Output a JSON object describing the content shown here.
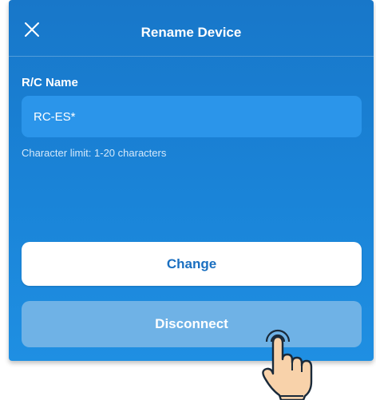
{
  "header": {
    "title": "Rename Device",
    "close_icon": "close-icon"
  },
  "form": {
    "label": "R/C Name",
    "value": "RC-ES*",
    "hint": "Character limit: 1-20 characters"
  },
  "actions": {
    "change_label": "Change",
    "disconnect_label": "Disconnect"
  },
  "overlay": {
    "pointer_icon": "tap-hand-icon"
  },
  "colors": {
    "panel": "#1a84d8",
    "input_bg": "#2b95ea",
    "primary_button_text": "#1a6fc0",
    "secondary_button_bg": "#6fb2e6"
  }
}
